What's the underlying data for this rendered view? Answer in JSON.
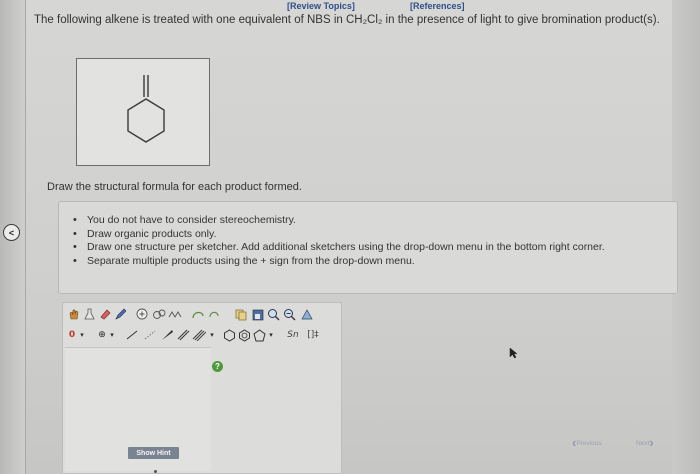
{
  "nav": {
    "review_topics": "[Review Topics]",
    "references": "[References]",
    "previous": "Previous",
    "next": "Next"
  },
  "question": {
    "text": "The following alkene is treated with one equivalent of NBS in CH₂Cl₂ in the presence of light to give bromination product(s).",
    "instruction": "Draw the structural formula for each product formed."
  },
  "hints": [
    "You do not have to consider stereochemistry.",
    "Draw organic products only.",
    "Draw one structure per sketcher. Add additional sketchers using the drop-down menu in the bottom right corner.",
    "Separate multiple products using the + sign from the drop-down menu."
  ],
  "sketcher": {
    "charge_label": "0",
    "plus_label": "⊕",
    "template_label": "Sn",
    "bracket_label": "[]‡",
    "show_hint": "Show Hint",
    "help": "?"
  },
  "colors": {
    "link": "#2f4f8a",
    "hint_button": "#7a8391",
    "help_green": "#4e9a3a"
  }
}
